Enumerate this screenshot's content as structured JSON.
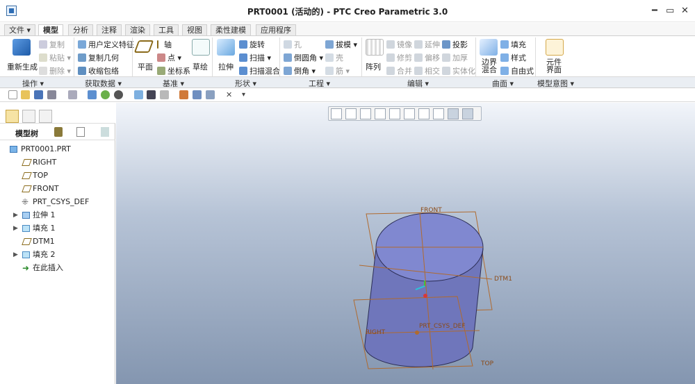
{
  "window": {
    "title": "PRT0001 (活动的) - PTC Creo Parametric 3.0",
    "ctl_help": "▭",
    "ctl_min": "━",
    "ctl_max": "▭",
    "ctl_close": "✕"
  },
  "tabs": [
    {
      "label": "文件 ▾"
    },
    {
      "label": "模型"
    },
    {
      "label": "分析"
    },
    {
      "label": "注释"
    },
    {
      "label": "渲染"
    },
    {
      "label": "工具"
    },
    {
      "label": "视图"
    },
    {
      "label": "柔性建模"
    },
    {
      "label": "应用程序"
    }
  ],
  "ribbon": {
    "regen": "重新生成",
    "copy": "复制",
    "paste": "粘贴 ▾",
    "delete": "删除 ▾",
    "udf": "用户定义特征",
    "copy_geom": "复制几何",
    "shrinkwrap": "收缩包络",
    "plane": "平面",
    "axis": "轴",
    "point": "点 ▾",
    "csys": "坐标系",
    "sketch": "草绘",
    "extrude": "拉伸",
    "revolve": "旋转",
    "sweep": "扫描 ▾",
    "swept_blend": "扫描混合",
    "hole": "孔",
    "round": "倒圆角 ▾",
    "chamfer": "倒角 ▾",
    "draft": "拔模 ▾",
    "shell": "壳",
    "rib": "筋 ▾",
    "pattern": "阵列",
    "mirror": "镜像",
    "trim": "修剪",
    "merge": "合并",
    "extend": "延伸",
    "offset": "偏移",
    "intersect": "相交",
    "project": "投影",
    "thicken": "加厚",
    "solidify": "实体化",
    "boundary": "边界",
    "boundary2": "混合",
    "fill": "填充",
    "style": "样式",
    "freestyle": "自由式",
    "component": "元件",
    "component2": "界面"
  },
  "groups": [
    {
      "label": "操作 ▾"
    },
    {
      "label": "获取数据 ▾"
    },
    {
      "label": "基准 ▾"
    },
    {
      "label": "形状 ▾"
    },
    {
      "label": "工程 ▾"
    },
    {
      "label": "编辑 ▾"
    },
    {
      "label": "曲面 ▾"
    },
    {
      "label": "模型意图 ▾"
    }
  ],
  "qat_more": "▾",
  "tree": {
    "header": "模型树",
    "items": [
      {
        "label": "PRT0001.PRT",
        "icon": "part-icon",
        "expandable": false
      },
      {
        "label": "RIGHT",
        "icon": "datum-plane-icon",
        "expandable": false
      },
      {
        "label": "TOP",
        "icon": "datum-plane-icon",
        "expandable": false
      },
      {
        "label": "FRONT",
        "icon": "datum-plane-icon",
        "expandable": false
      },
      {
        "label": "PRT_CSYS_DEF",
        "icon": "csys-icon",
        "expandable": false
      },
      {
        "label": "拉伸 1",
        "icon": "extrude-icon",
        "expandable": true
      },
      {
        "label": "填充 1",
        "icon": "fill-icon",
        "expandable": true
      },
      {
        "label": "DTM1",
        "icon": "datum-plane-icon",
        "expandable": false
      },
      {
        "label": "填充 2",
        "icon": "fill-icon",
        "expandable": true
      },
      {
        "label": "在此插入",
        "icon": "insert-here-icon",
        "expandable": false
      }
    ],
    "expand_glyph": "▶"
  },
  "viewport": {
    "label_front": "FRONT",
    "label_dtm1": "DTM1",
    "label_right": "RIGHT",
    "label_csys": "PRT_CSYS_DEF",
    "label_top": "TOP"
  },
  "colors": {
    "datum": "#b06a2e",
    "solid": "#7c83c9",
    "accent": "#2d6db5"
  }
}
